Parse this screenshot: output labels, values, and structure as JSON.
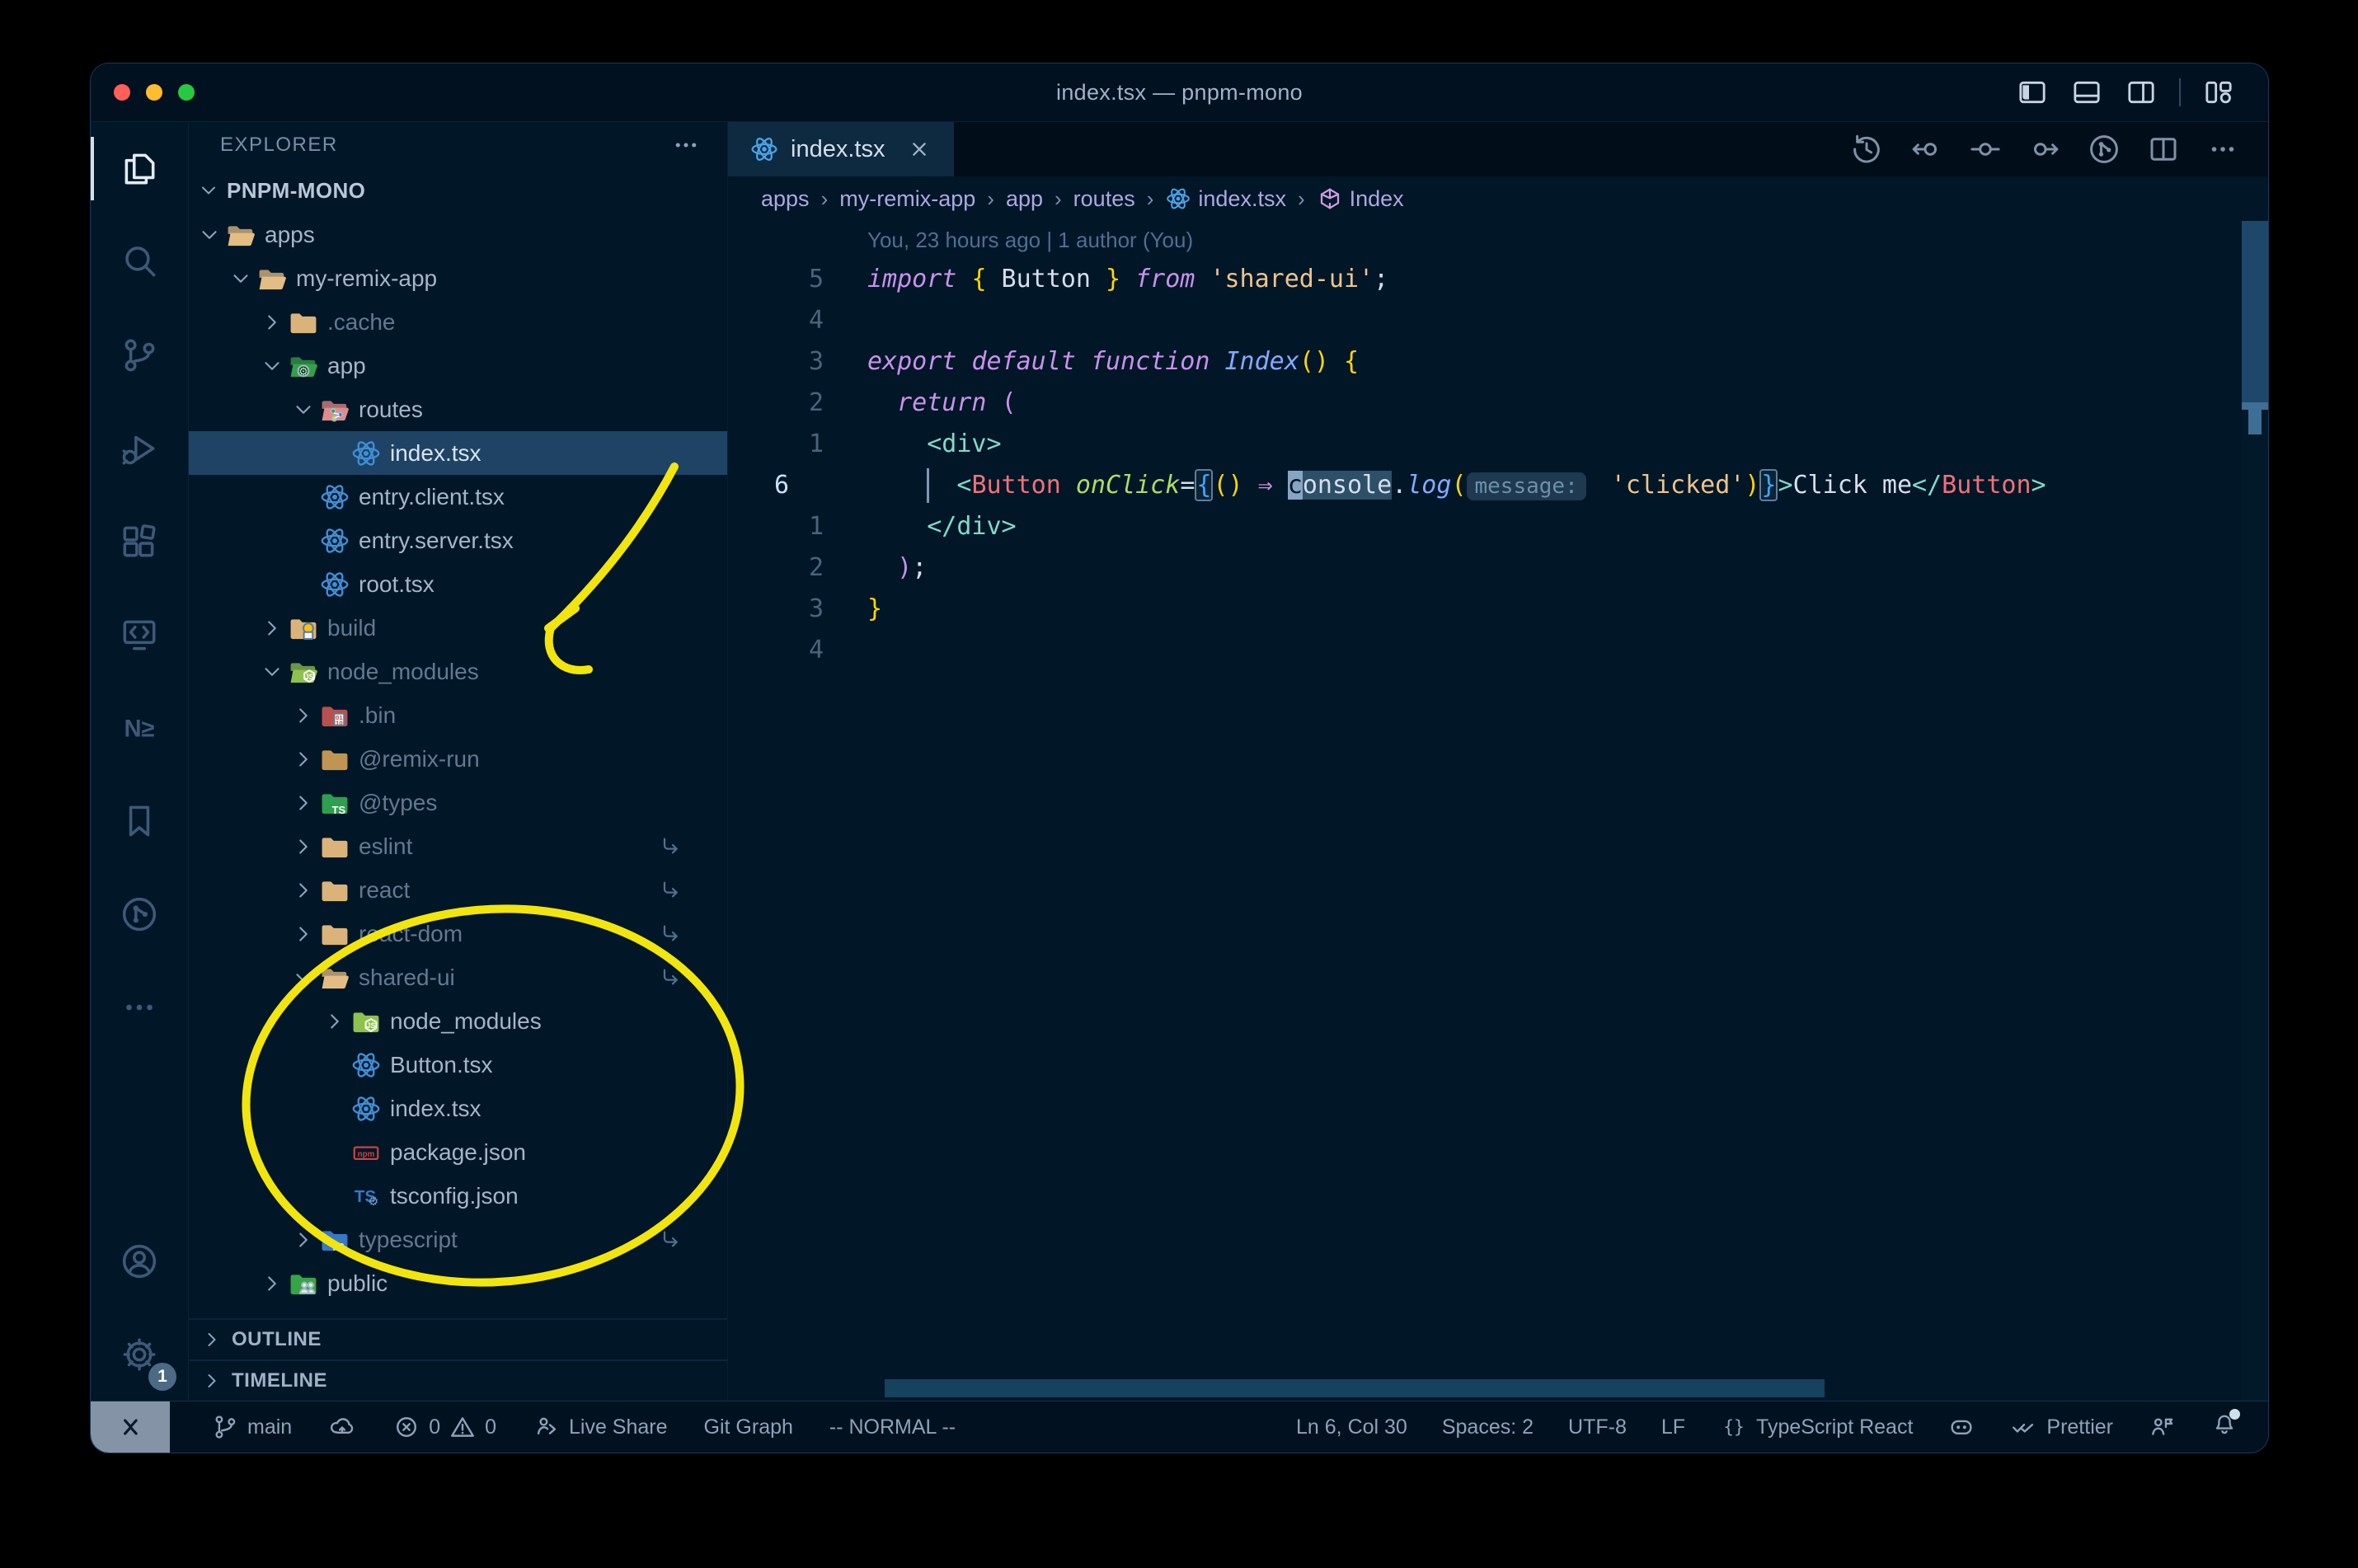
{
  "window": {
    "title": "index.tsx — pnpm-mono"
  },
  "title_bar": {
    "traffic_lights": [
      "#ff5f57",
      "#febc2e",
      "#28c840"
    ],
    "layout_icons": [
      "toggle-sidebar-icon",
      "toggle-panel-icon",
      "toggle-secondary-sidebar-icon",
      "customize-layout-icon"
    ]
  },
  "activity_bar": {
    "top": [
      {
        "icon": "files-icon",
        "active": true
      },
      {
        "icon": "search-icon"
      },
      {
        "icon": "source-control-icon"
      },
      {
        "icon": "run-debug-icon"
      },
      {
        "icon": "extensions-icon"
      },
      {
        "icon": "remote-explorer-icon"
      },
      {
        "icon": "nx-console-icon"
      },
      {
        "icon": "bookmarks-icon"
      },
      {
        "icon": "git-graph-activity-icon"
      },
      {
        "icon": "more-views-icon"
      }
    ],
    "bottom": [
      {
        "icon": "account-icon"
      },
      {
        "icon": "settings-gear-icon",
        "badge": "1"
      }
    ]
  },
  "sidebar": {
    "header": "EXPLORER",
    "section": "PNPM-MONO",
    "tree": [
      {
        "label": "apps",
        "level": 0,
        "icon": "folder-open-tan",
        "chevron": "open"
      },
      {
        "label": "my-remix-app",
        "level": 1,
        "icon": "folder-open-tan",
        "chevron": "open"
      },
      {
        "label": ".cache",
        "level": 2,
        "icon": "folder-tan",
        "chevron": "closed",
        "dim": true
      },
      {
        "label": "app",
        "level": 2,
        "icon": "folder-open-app",
        "chevron": "open"
      },
      {
        "label": "routes",
        "level": 3,
        "icon": "folder-open-routes",
        "chevron": "open"
      },
      {
        "label": "index.tsx",
        "level": 4,
        "icon": "react-file-icon",
        "chevron": "none",
        "selected": true
      },
      {
        "label": "entry.client.tsx",
        "level": 3,
        "icon": "react-file-icon",
        "chevron": "none"
      },
      {
        "label": "entry.server.tsx",
        "level": 3,
        "icon": "react-file-icon",
        "chevron": "none"
      },
      {
        "label": "root.tsx",
        "level": 3,
        "icon": "react-file-icon",
        "chevron": "none"
      },
      {
        "label": "build",
        "level": 2,
        "icon": "folder-build",
        "chevron": "closed",
        "dim": true
      },
      {
        "label": "node_modules",
        "level": 2,
        "icon": "folder-open-nm",
        "chevron": "open",
        "dim": true
      },
      {
        "label": ".bin",
        "level": 3,
        "icon": "folder-bin",
        "chevron": "closed",
        "dim": true
      },
      {
        "label": "@remix-run",
        "level": 3,
        "icon": "folder-remix",
        "chevron": "closed",
        "dim": true
      },
      {
        "label": "@types",
        "level": 3,
        "icon": "folder-types",
        "chevron": "closed",
        "dim": true
      },
      {
        "label": "eslint",
        "level": 3,
        "icon": "folder-tan",
        "chevron": "closed",
        "dim": true,
        "symlink": true
      },
      {
        "label": "react",
        "level": 3,
        "icon": "folder-tan",
        "chevron": "closed",
        "dim": true,
        "symlink": true
      },
      {
        "label": "react-dom",
        "level": 3,
        "icon": "folder-tan",
        "chevron": "closed",
        "dim": true,
        "symlink": true
      },
      {
        "label": "shared-ui",
        "level": 3,
        "icon": "folder-open-tan",
        "chevron": "open",
        "dim": true,
        "symlink": true
      },
      {
        "label": "node_modules",
        "level": 4,
        "icon": "folder-nm",
        "chevron": "closed"
      },
      {
        "label": "Button.tsx",
        "level": 4,
        "icon": "react-file-icon",
        "chevron": "none"
      },
      {
        "label": "index.tsx",
        "level": 4,
        "icon": "react-file-icon",
        "chevron": "none"
      },
      {
        "label": "package.json",
        "level": 4,
        "icon": "npm-file-icon",
        "chevron": "none"
      },
      {
        "label": "tsconfig.json",
        "level": 4,
        "icon": "tsconfig-file-icon",
        "chevron": "none"
      },
      {
        "label": "typescript",
        "level": 3,
        "icon": "folder-ts",
        "chevron": "closed",
        "dim": true,
        "symlink": true
      },
      {
        "label": "public",
        "level": 2,
        "icon": "folder-public",
        "chevron": "closed"
      }
    ],
    "panels": [
      "OUTLINE",
      "TIMELINE"
    ]
  },
  "editor": {
    "tab": {
      "icon": "react-icon",
      "label": "index.tsx"
    },
    "actions": [
      "history-icon",
      "previous-change-icon",
      "open-changes-icon",
      "next-change-icon",
      "gitlens-graph-icon",
      "split-editor-icon",
      "more-actions-icon"
    ],
    "breadcrumbs": [
      {
        "label": "apps"
      },
      {
        "label": "my-remix-app"
      },
      {
        "label": "app"
      },
      {
        "label": "routes"
      },
      {
        "label": "index.tsx",
        "icon": "react-icon"
      },
      {
        "label": "Index",
        "icon": "symbol-module-icon"
      }
    ],
    "blame": "You, 23 hours ago | 1 author (You)",
    "code": {
      "lines": [
        {
          "n": "5",
          "t": [
            [
              "kw",
              "import"
            ],
            [
              "pl",
              " "
            ],
            [
              "by",
              "{"
            ],
            [
              "pl",
              " Button "
            ],
            [
              "by",
              "}"
            ],
            [
              "pl",
              " "
            ],
            [
              "kw",
              "from"
            ],
            [
              "pl",
              " "
            ],
            [
              "str",
              "'shared-ui'"
            ],
            [
              "pl",
              ";"
            ]
          ]
        },
        {
          "n": "4",
          "t": []
        },
        {
          "n": "3",
          "t": [
            [
              "kw",
              "export"
            ],
            [
              "pl",
              " "
            ],
            [
              "kw",
              "default"
            ],
            [
              "pl",
              " "
            ],
            [
              "kw",
              "function"
            ],
            [
              "pl",
              " "
            ],
            [
              "fn",
              "Index"
            ],
            [
              "by",
              "()"
            ],
            [
              "pl",
              " "
            ],
            [
              "by",
              "{"
            ]
          ]
        },
        {
          "n": "2",
          "t": [
            [
              "pl",
              "  "
            ],
            [
              "kw",
              "return"
            ],
            [
              "pl",
              " "
            ],
            [
              "pnk",
              "("
            ]
          ]
        },
        {
          "n": "1",
          "t": [
            [
              "pl",
              "    "
            ],
            [
              "tag",
              "<div>"
            ]
          ]
        },
        {
          "n": "6",
          "current": true,
          "t": [
            [
              "pl",
              "      "
            ],
            [
              "tag",
              "<"
            ],
            [
              "comp",
              "Button"
            ],
            [
              "pl",
              " "
            ],
            [
              "attr",
              "onClick"
            ],
            [
              "pl",
              "="
            ],
            [
              "bbm",
              "{"
            ],
            [
              "by",
              "()"
            ],
            [
              "pl",
              " "
            ],
            [
              "pnk",
              "⇒"
            ],
            [
              "pl",
              " "
            ],
            [
              "cur",
              "c"
            ],
            [
              "sel",
              "onsole"
            ],
            [
              "pl",
              "."
            ],
            [
              "fn",
              "log"
            ],
            [
              "by",
              "("
            ],
            [
              "hint",
              "message:"
            ],
            [
              "pl",
              " "
            ],
            [
              "str",
              "'clicked'"
            ],
            [
              "by",
              ")"
            ],
            [
              "bbm",
              "}"
            ],
            [
              "tag",
              ">"
            ],
            [
              "pl",
              "Click me"
            ],
            [
              "tag",
              "</"
            ],
            [
              "comp",
              "Button"
            ],
            [
              "tag",
              ">"
            ]
          ]
        },
        {
          "n": "1",
          "t": [
            [
              "pl",
              "    "
            ],
            [
              "tag",
              "</div>"
            ]
          ]
        },
        {
          "n": "2",
          "t": [
            [
              "pl",
              "  "
            ],
            [
              "pnk",
              ")"
            ],
            [
              "pl",
              ";"
            ]
          ]
        },
        {
          "n": "3",
          "t": [
            [
              "by",
              "}"
            ]
          ]
        },
        {
          "n": "4",
          "t": []
        }
      ]
    }
  },
  "status_bar": {
    "left": [
      {
        "icon": "remote-icon",
        "kind": "remote",
        "name": "remote-indicator"
      },
      {
        "icon": "git-branch-icon",
        "label": "main",
        "name": "branch-status"
      },
      {
        "icon": "cloud-upload-icon",
        "name": "publish-changes"
      },
      {
        "parts": [
          {
            "icon": "error-icon",
            "label": "0"
          },
          {
            "icon": "warning-icon",
            "label": "0"
          }
        ],
        "name": "problems-status"
      },
      {
        "icon": "live-share-icon",
        "label": "Live Share",
        "name": "live-share"
      },
      {
        "label": "Git Graph",
        "name": "git-graph-status"
      },
      {
        "label": "-- NORMAL --",
        "name": "vim-mode"
      }
    ],
    "right": [
      {
        "label": "Ln 6, Col 30",
        "name": "cursor-position"
      },
      {
        "label": "Spaces: 2",
        "name": "indentation"
      },
      {
        "label": "UTF-8",
        "name": "encoding"
      },
      {
        "label": "LF",
        "name": "eol"
      },
      {
        "icon": "braces-icon",
        "label": "TypeScript React",
        "name": "language-mode"
      },
      {
        "icon": "copilot-icon",
        "name": "copilot-status"
      },
      {
        "icon": "prettier-check-icon",
        "label": "Prettier",
        "name": "prettier-status"
      },
      {
        "icon": "feedback-icon",
        "name": "feedback"
      },
      {
        "icon": "bell-icon",
        "dot": true,
        "name": "notifications"
      }
    ]
  },
  "annotations": {
    "color": "#f2e50e"
  }
}
